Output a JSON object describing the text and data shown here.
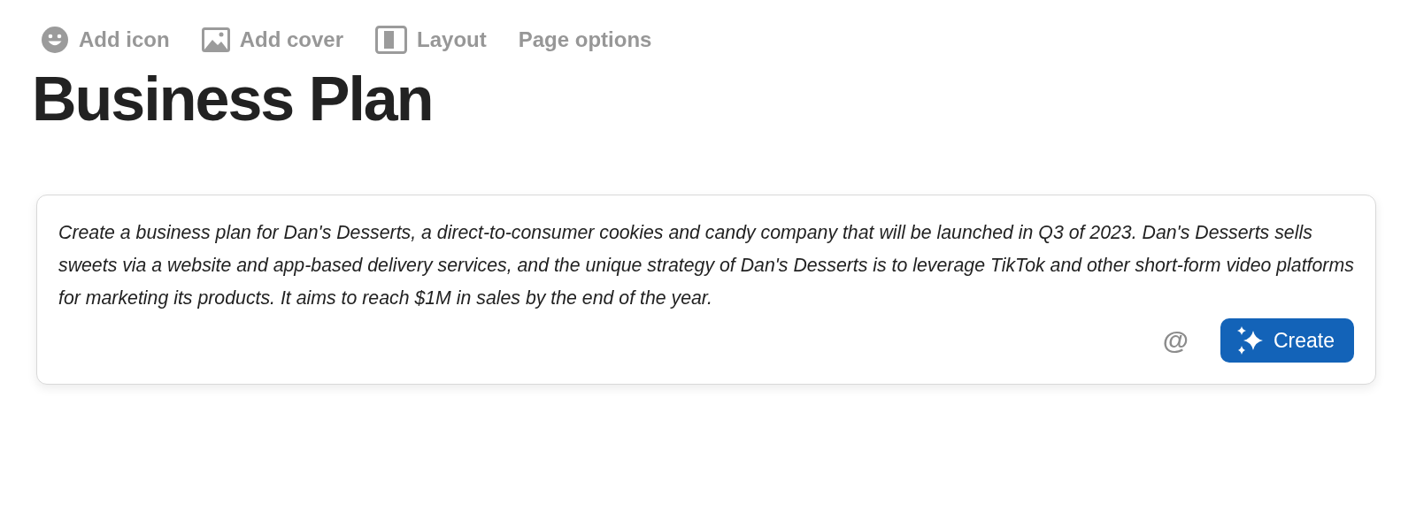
{
  "toolbar": [
    {
      "kind": "emoji",
      "label": "Add icon"
    },
    {
      "kind": "image",
      "label": "Add cover"
    },
    {
      "kind": "layout",
      "label": "Layout"
    },
    {
      "kind": "plain",
      "label": "Page options"
    }
  ],
  "title": "Business Plan",
  "prompt": {
    "value": "Create a business plan for Dan's Desserts, a direct-to-consumer cookies and candy company that will be launched in Q3 of 2023. Dan's Desserts sells sweets via a website and app-based delivery services, and the unique strategy of Dan's Desserts is to leverage TikTok and other short-form video platforms for marketing its products. It aims to reach $1M in sales by the end of the year.",
    "mention": "@",
    "button": "Create"
  }
}
